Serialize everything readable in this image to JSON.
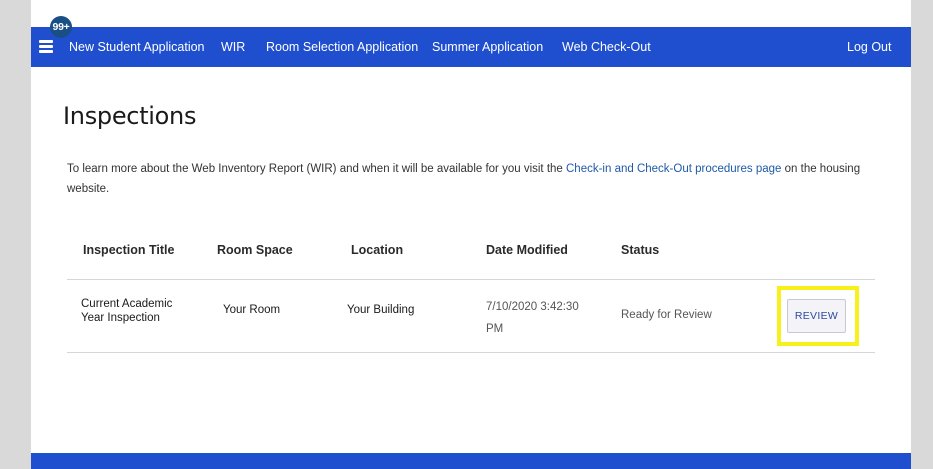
{
  "nav": {
    "badge": "99+",
    "links": [
      {
        "label": "New Student Application"
      },
      {
        "label": "WIR"
      },
      {
        "label": "Room Selection Application"
      },
      {
        "label": "Summer Application"
      },
      {
        "label": "Web Check-Out"
      }
    ],
    "logout": "Log Out"
  },
  "page": {
    "title": "Inspections",
    "intro_before": "To learn more about the Web Inventory Report (WIR) and when it will be available for you visit the ",
    "intro_link": "Check-in and Check-Out procedures page",
    "intro_after": " on the housing website."
  },
  "table": {
    "headers": [
      "Inspection Title",
      "Room Space",
      "Location",
      "Date Modified",
      "Status"
    ],
    "rows": [
      {
        "title": "Current Academic Year Inspection",
        "room_space": "Your Room",
        "location": "Your Building",
        "date_modified": "7/10/2020 3:42:30 PM",
        "status": "Ready for Review",
        "action": "REVIEW"
      }
    ]
  },
  "colors": {
    "navbar": "#1f4fcf",
    "highlight": "#f7f01a",
    "link": "#1e5aa8"
  }
}
